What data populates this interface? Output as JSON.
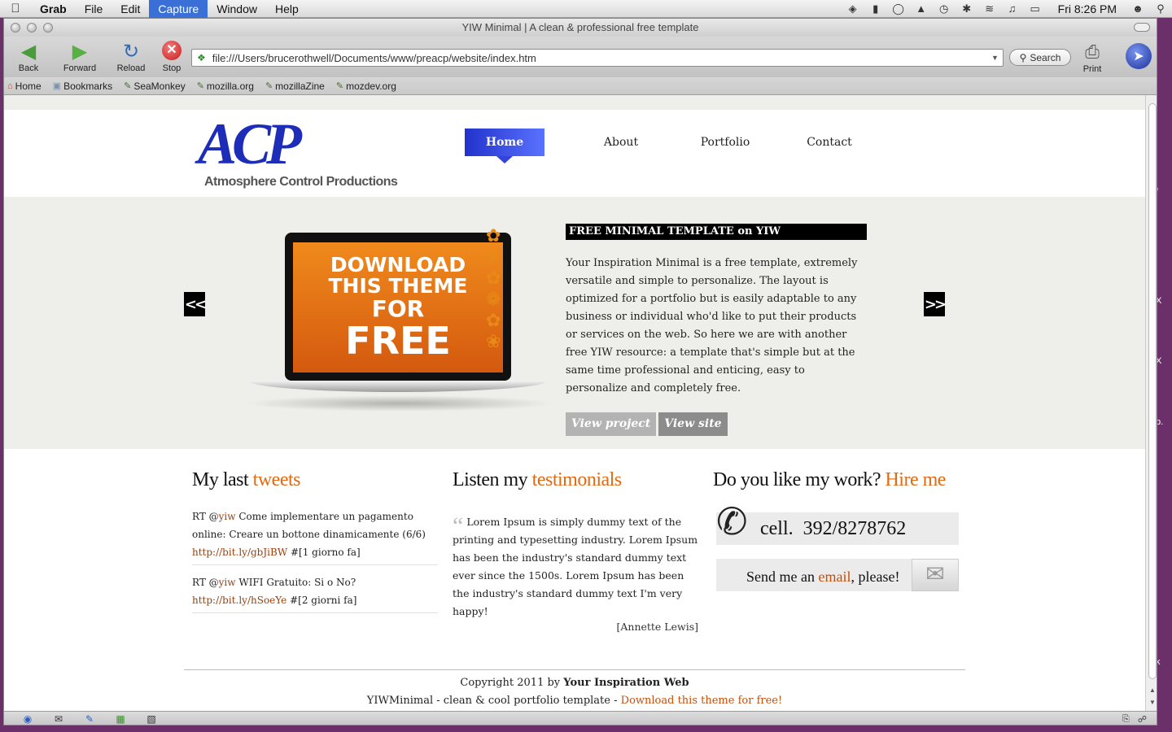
{
  "menubar": {
    "app": "Grab",
    "items": [
      "File",
      "Edit",
      "Capture",
      "Window",
      "Help"
    ],
    "clock": "Fri 8:26 PM"
  },
  "window": {
    "title": "YIW Minimal | A clean & professional free template"
  },
  "toolbar": {
    "back": "Back",
    "forward": "Forward",
    "reload": "Reload",
    "stop": "Stop",
    "url": "file:///Users/brucerothwell/Documents/www/preacp/website/index.htm",
    "search": "Search",
    "print": "Print"
  },
  "bookmarks": [
    "Home",
    "Bookmarks",
    "SeaMonkey",
    "mozilla.org",
    "mozillaZine",
    "mozdev.org"
  ],
  "site": {
    "logo_mark": "ACP",
    "logo_sub": "Atmosphere Control Productions",
    "nav": [
      "Home",
      "About",
      "Portfolio",
      "Contact"
    ],
    "slide": {
      "image_lines": [
        "DOWNLOAD",
        "THIS THEME",
        "FOR",
        "FREE"
      ],
      "title": "FREE MINIMAL TEMPLATE on YIW",
      "description": "Your Inspiration Minimal is a free template, extremely versatile and simple to personalize. The layout is optimized for a portfolio but is easily adaptable to any business or individual who'd like to put their products or services on the web. So here we are with another free YIW resource: a template that's simple but at the same time professional and enticing, easy to personalize and completely free.",
      "view_project": "View project",
      "view_site": "View site"
    },
    "tweets": {
      "heading": "My last ",
      "heading_accent": "tweets",
      "items": [
        {
          "prefix": "RT @",
          "user": "yiw",
          "text": " Come implementare un pagamento online: Creare un bottone dinamicamente (6/6) ",
          "link": "http://bit.ly/gbJiBW",
          "suffix": " #[1 giorno fa]"
        },
        {
          "prefix": "RT @",
          "user": "yiw",
          "text": " WIFI Gratuito: Si o No? ",
          "link": "http://bit.ly/hSoeYe",
          "suffix": " #[2 giorni fa]"
        }
      ]
    },
    "testimonials": {
      "heading": "Listen my ",
      "heading_accent": "testimonials",
      "quote": "Lorem Ipsum is simply dummy text of the printing and typesetting industry. Lorem Ipsum has been the industry's standard dummy text ever since the 1500s. Lorem Ipsum has been the industry's standard dummy text I'm very happy!",
      "author": "[Annette Lewis]"
    },
    "hire": {
      "heading": "Do you like my work? ",
      "heading_accent": "Hire me",
      "cell": "cell.  392/8278762",
      "email_pre": "Send me an ",
      "email_link": "email",
      "email_post": ", please!"
    },
    "footer": {
      "copyright_pre": "Copyright 2011 by ",
      "copyright_owner": "Your Inspiration Web",
      "tagline": "YIWMinimal - clean & cool portfolio template - ",
      "download_link": "Download this theme for free!"
    }
  }
}
